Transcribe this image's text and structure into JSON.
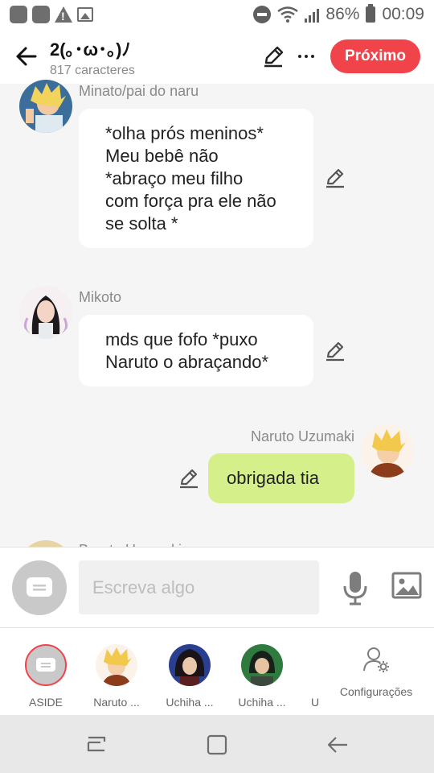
{
  "status_bar": {
    "battery": "86%",
    "time": "00:09"
  },
  "header": {
    "title": "2(｡･ω･｡)ﾉ",
    "subtitle": "817 caracteres",
    "next_label": "Próximo",
    "next_color": "#f0444a"
  },
  "messages": [
    {
      "sender": "Minato/pai do naru",
      "lines": [
        "*olha prós meninos*",
        "Meu bebê não",
        "*abraço meu filho",
        "com força pra ele não",
        "se solta *"
      ]
    },
    {
      "sender": "Mikoto",
      "lines": [
        "mds que fofo *puxo",
        "Naruto o abraçando*"
      ]
    },
    {
      "sender": "Naruto Uzumaki",
      "lines": [
        "obrigada tia"
      ],
      "bubble_color": "#d5f08a"
    },
    {
      "sender": "Boruto Uzumaki"
    }
  ],
  "composer": {
    "placeholder": "Escreva algo"
  },
  "characters": [
    {
      "label": "ASIDE"
    },
    {
      "label": "Naruto ..."
    },
    {
      "label": "Uchiha ..."
    },
    {
      "label": "Uchiha ..."
    },
    {
      "label": "U"
    }
  ],
  "settings_label": "Configurações",
  "accent_color": "#f0444a"
}
